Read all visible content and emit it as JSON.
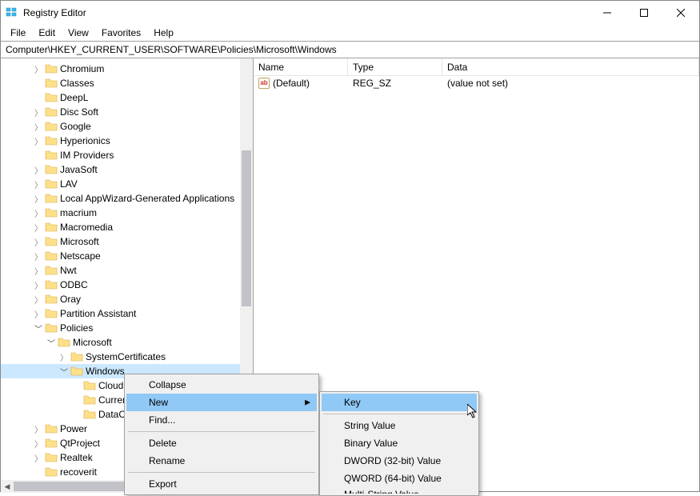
{
  "window": {
    "title": "Registry Editor"
  },
  "menu": {
    "file": "File",
    "edit": "Edit",
    "view": "View",
    "favorites": "Favorites",
    "help": "Help"
  },
  "address": {
    "path": "Computer\\HKEY_CURRENT_USER\\SOFTWARE\\Policies\\Microsoft\\Windows"
  },
  "tree": [
    {
      "indent": 2,
      "exp": ">",
      "label": "Chromium"
    },
    {
      "indent": 2,
      "exp": "",
      "label": "Classes"
    },
    {
      "indent": 2,
      "exp": "",
      "label": "DeepL"
    },
    {
      "indent": 2,
      "exp": ">",
      "label": "Disc Soft"
    },
    {
      "indent": 2,
      "exp": ">",
      "label": "Google"
    },
    {
      "indent": 2,
      "exp": ">",
      "label": "Hyperionics"
    },
    {
      "indent": 2,
      "exp": "",
      "label": "IM Providers"
    },
    {
      "indent": 2,
      "exp": ">",
      "label": "JavaSoft"
    },
    {
      "indent": 2,
      "exp": ">",
      "label": "LAV"
    },
    {
      "indent": 2,
      "exp": ">",
      "label": "Local AppWizard-Generated Applications"
    },
    {
      "indent": 2,
      "exp": ">",
      "label": "macrium"
    },
    {
      "indent": 2,
      "exp": ">",
      "label": "Macromedia"
    },
    {
      "indent": 2,
      "exp": ">",
      "label": "Microsoft"
    },
    {
      "indent": 2,
      "exp": ">",
      "label": "Netscape"
    },
    {
      "indent": 2,
      "exp": ">",
      "label": "Nwt"
    },
    {
      "indent": 2,
      "exp": ">",
      "label": "ODBC"
    },
    {
      "indent": 2,
      "exp": ">",
      "label": "Oray"
    },
    {
      "indent": 2,
      "exp": ">",
      "label": "Partition Assistant"
    },
    {
      "indent": 2,
      "exp": "v",
      "label": "Policies"
    },
    {
      "indent": 3,
      "exp": "v",
      "label": "Microsoft"
    },
    {
      "indent": 4,
      "exp": ">",
      "label": "SystemCertificates"
    },
    {
      "indent": 4,
      "exp": "v",
      "label": "Windows",
      "selected": true
    },
    {
      "indent": 5,
      "exp": "",
      "label": "CloudC"
    },
    {
      "indent": 5,
      "exp": "",
      "label": "Curren"
    },
    {
      "indent": 5,
      "exp": "",
      "label": "DataCo"
    },
    {
      "indent": 2,
      "exp": ">",
      "label": "Power"
    },
    {
      "indent": 2,
      "exp": ">",
      "label": "QtProject"
    },
    {
      "indent": 2,
      "exp": ">",
      "label": "Realtek"
    },
    {
      "indent": 2,
      "exp": "",
      "label": "recoverit"
    }
  ],
  "list": {
    "columns": {
      "name": "Name",
      "type": "Type",
      "data": "Data"
    },
    "rows": [
      {
        "name": "(Default)",
        "type": "REG_SZ",
        "data": "(value not set)"
      }
    ]
  },
  "context_menu": {
    "collapse": "Collapse",
    "new": "New",
    "find": "Find...",
    "delete": "Delete",
    "rename": "Rename",
    "export": "Export"
  },
  "submenu": {
    "key": "Key",
    "string": "String Value",
    "binary": "Binary Value",
    "dword": "DWORD (32-bit) Value",
    "qword": "QWORD (64-bit) Value",
    "multi": "Multi-String Value"
  }
}
